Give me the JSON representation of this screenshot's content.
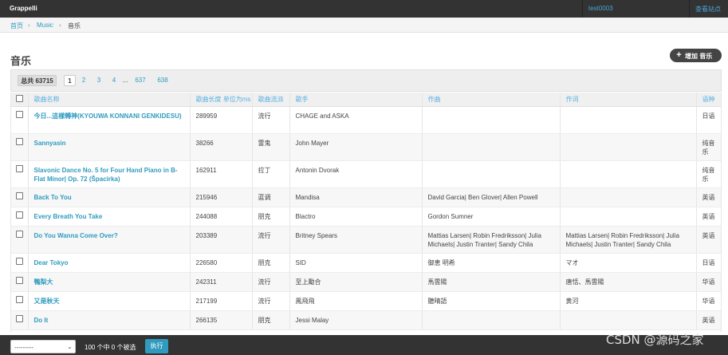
{
  "topbar": {
    "brand": "Grappelli",
    "user": "test0003",
    "view_site": "查看站点"
  },
  "breadcrumbs": {
    "home": "首页",
    "app": "Music",
    "current": "音乐"
  },
  "page": {
    "title": "音乐",
    "add_button": "增加 音乐",
    "add_icon": "plus-icon"
  },
  "pagination": {
    "total": "总共 63715",
    "current": "1",
    "links": [
      "2",
      "3",
      "4"
    ],
    "ellipsis": "...",
    "last_links": [
      "637",
      "638"
    ]
  },
  "table": {
    "columns": [
      "歌曲名称",
      "歌曲长度 单位为ms",
      "歌曲流派",
      "歌手",
      "作曲",
      "作词",
      "语种"
    ],
    "rows": [
      {
        "name": "今日...這樣轉神(KYOUWA KONNANI GENKIDESU)",
        "length": "289959",
        "genre": "流行",
        "singer": "CHAGE and ASKA",
        "composer": "",
        "lyricist": "",
        "language": "日语"
      },
      {
        "name": "Sannyasin",
        "length": "38266",
        "genre": "雷鬼",
        "singer": "John Mayer",
        "composer": "",
        "lyricist": "",
        "language": "纯音乐"
      },
      {
        "name": "Slavonic Dance No. 5 for Four Hand Piano in B-Flat Minor| Op. 72 (Špacirka)",
        "length": "162911",
        "genre": "拉丁",
        "singer": "Antonin Dvorak",
        "composer": "",
        "lyricist": "",
        "language": "纯音乐"
      },
      {
        "name": "Back To You",
        "length": "215946",
        "genre": "蓝调",
        "singer": "Mandisa",
        "composer": "David Garcia| Ben Glover| Allen Powell",
        "lyricist": "",
        "language": "英语"
      },
      {
        "name": "Every Breath You Take",
        "length": "244088",
        "genre": "朋克",
        "singer": "Blactro",
        "composer": "Gordon Sumner",
        "lyricist": "",
        "language": "英语"
      },
      {
        "name": "Do You Wanna Come Over?",
        "length": "203389",
        "genre": "流行",
        "singer": "Britney Spears",
        "composer": "Mattias Larsen| Robin Fredriksson| Julia Michaels| Justin Tranter| Sandy Chila",
        "lyricist": "Mattias Larsen| Robin Fredriksson| Julia Michaels| Justin Tranter| Sandy Chila",
        "language": "英语"
      },
      {
        "name": "Dear Tokyo",
        "length": "226580",
        "genre": "朋克",
        "singer": "SID",
        "composer": "御恵 明希",
        "lyricist": "マオ",
        "language": "日语"
      },
      {
        "name": "鴨梨大",
        "length": "242311",
        "genre": "流行",
        "singer": "至上勵合",
        "composer": "馬雲陽",
        "lyricist": "唐恬、馬雲陽",
        "language": "华语"
      },
      {
        "name": "又是秋天",
        "length": "217199",
        "genre": "流行",
        "singer": "鳳飛飛",
        "composer": "聽晴語",
        "lyricist": "黄河",
        "language": "华语"
      },
      {
        "name": "Do It",
        "length": "266135",
        "genre": "朋克",
        "singer": "Jessi Malay",
        "composer": "",
        "lyricist": "",
        "language": "英语"
      }
    ]
  },
  "footer": {
    "action_select": "---------",
    "selected_count": "100 个中 0 个被选",
    "run_button": "执行"
  },
  "watermark": "CSDN @源码之家",
  "colors": {
    "topbar": "#333333",
    "link": "#309bbf",
    "header_text": "#59afe1",
    "run_button": "#309bbf"
  }
}
